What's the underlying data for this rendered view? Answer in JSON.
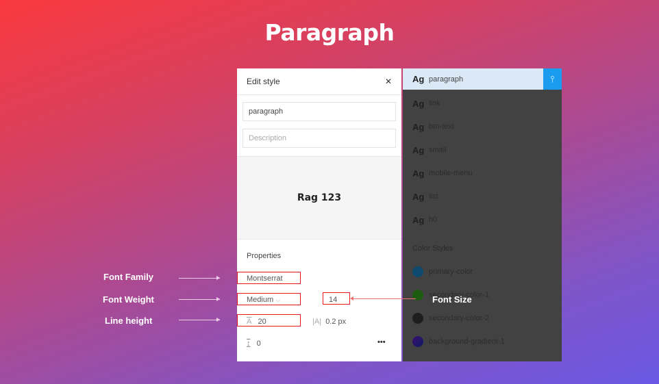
{
  "title": "Paragraph",
  "edit_panel": {
    "header": "Edit style",
    "name_value": "paragraph",
    "description_placeholder": "Description",
    "preview_text": "Rag 123",
    "properties_label": "Properties",
    "font_family": "Montserrat",
    "font_weight": "Medium",
    "font_size": "14",
    "line_height": "20",
    "letter_spacing": "0.2 px",
    "paragraph_spacing": "0",
    "more": "•••"
  },
  "styles_panel": {
    "text_styles": [
      {
        "glyph": "Ag",
        "name": "paragraph"
      },
      {
        "glyph": "Ag",
        "name": "link"
      },
      {
        "glyph": "Ag",
        "name": "btn-text"
      },
      {
        "glyph": "Ag",
        "name": "small"
      },
      {
        "glyph": "Ag",
        "name": "mobile-menu"
      },
      {
        "glyph": "Ag",
        "name": "list"
      },
      {
        "glyph": "Ag",
        "name": "h0"
      }
    ],
    "color_section": "Color Styles",
    "color_styles": [
      {
        "name": "primary-color",
        "color": "#0d4a6e"
      },
      {
        "name": "secondary-color-1",
        "color": "#1d5c10"
      },
      {
        "name": "secondary-color-2",
        "color": "#1e1e1e"
      },
      {
        "name": "background-gradient-1",
        "color": "#2a1a5a"
      }
    ]
  },
  "annotations": {
    "font_family": "Font Family",
    "font_weight": "Font Weight",
    "line_height": "Line height",
    "font_size": "Font Size"
  }
}
